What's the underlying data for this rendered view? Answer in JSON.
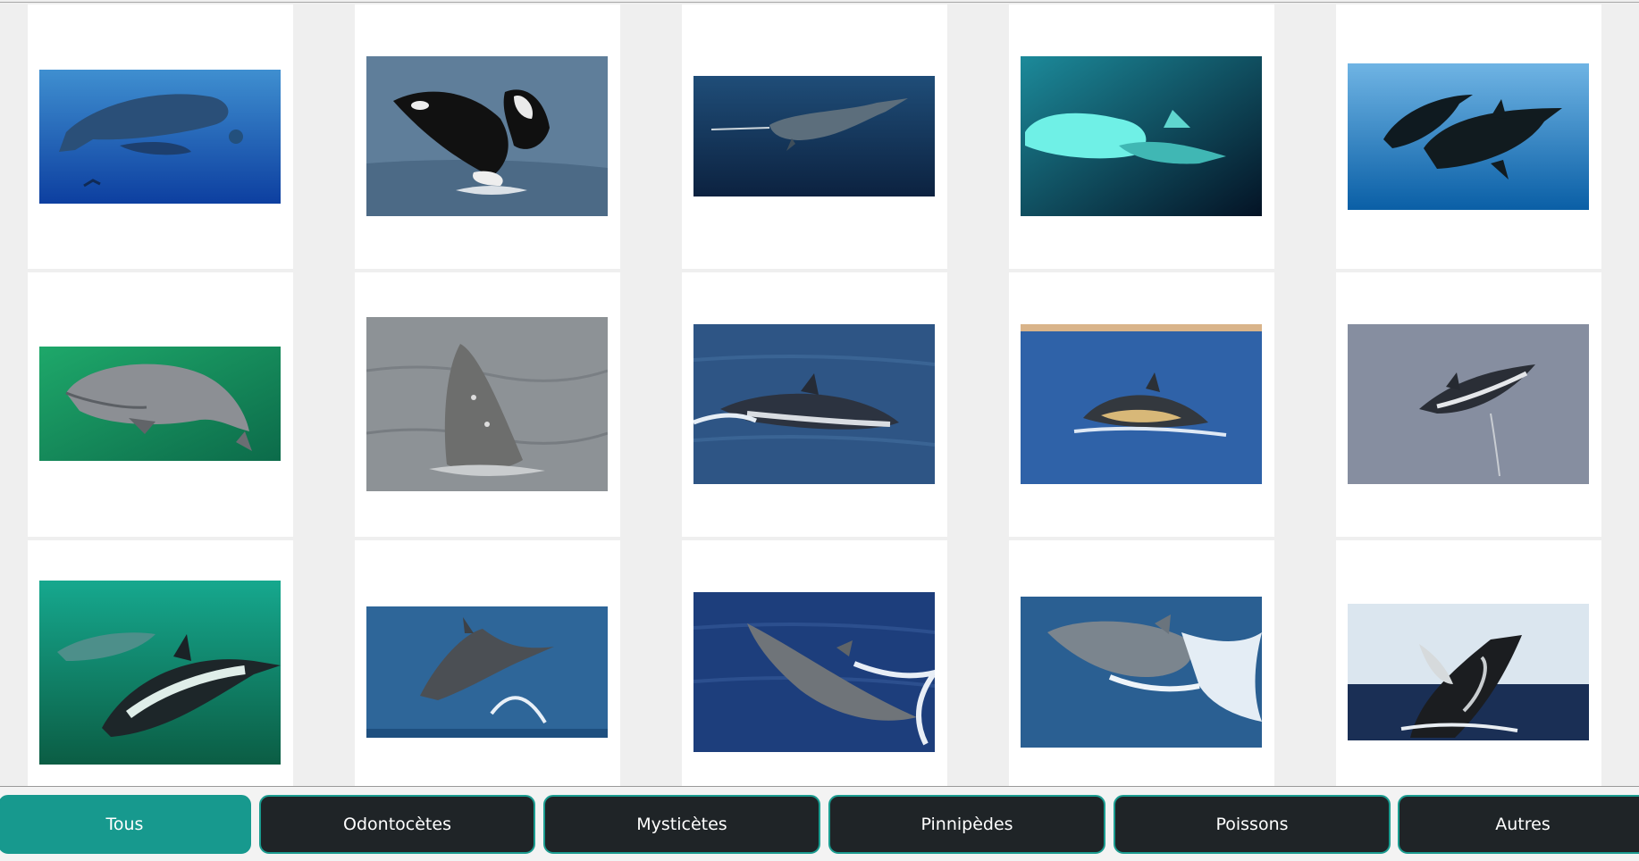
{
  "gallery": {
    "items": [
      {
        "subject": "sperm-whale-pod-with-diver"
      },
      {
        "subject": "orca-breaching"
      },
      {
        "subject": "narwhal-underwater"
      },
      {
        "subject": "beluga-whales-underwater"
      },
      {
        "subject": "pilot-whales-underwater"
      },
      {
        "subject": "porpoise-green-water"
      },
      {
        "subject": "rissos-dolphin-spyhop"
      },
      {
        "subject": "striped-dolphin-leaping"
      },
      {
        "subject": "common-dolphin-surfacing"
      },
      {
        "subject": "atlantic-white-sided-dolphin-leaping"
      },
      {
        "subject": "white-sided-dolphins-underwater"
      },
      {
        "subject": "rissos-dolphin-breaching"
      },
      {
        "subject": "spotted-dolphin-surfacing"
      },
      {
        "subject": "bottlenose-dolphin-surfacing"
      },
      {
        "subject": "humpback-whale-breaching"
      }
    ]
  },
  "tabs": {
    "items": [
      {
        "label": "Tous",
        "active": true
      },
      {
        "label": "Odontocètes",
        "active": false
      },
      {
        "label": "Mysticètes",
        "active": false
      },
      {
        "label": "Pinnipèdes",
        "active": false
      },
      {
        "label": "Poissons",
        "active": false
      },
      {
        "label": "Autres",
        "active": false
      }
    ]
  },
  "colors": {
    "accent": "#17998e",
    "tab_dark": "#1f2427",
    "background": "#efefef",
    "card": "#ffffff"
  }
}
